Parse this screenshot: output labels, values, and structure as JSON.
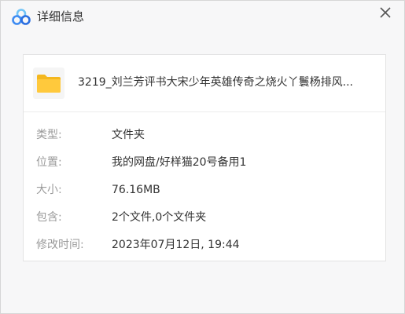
{
  "window": {
    "title": "详细信息",
    "close_symbol": "✕",
    "logo_icon": "cloud-logo-icon",
    "colors": {
      "logo_blue": "#3f8cf2",
      "logo_light": "#6fc3f7",
      "folder_yellow": "#ffc93c",
      "folder_dark": "#f4b71e"
    }
  },
  "file": {
    "icon": "folder-icon",
    "name": "3219_刘兰芳评书大宋少年英雄传奇之烧火丫鬟杨排风..."
  },
  "details": [
    {
      "label": "类型:",
      "value": "文件夹"
    },
    {
      "label": "位置:",
      "value": "我的网盘/好样猫20号备用1"
    },
    {
      "label": "大小:",
      "value": "76.16MB"
    },
    {
      "label": "包含:",
      "value": "2个文件,0个文件夹"
    },
    {
      "label": "修改时间:",
      "value": "2023年07月12日, 19:44"
    }
  ]
}
